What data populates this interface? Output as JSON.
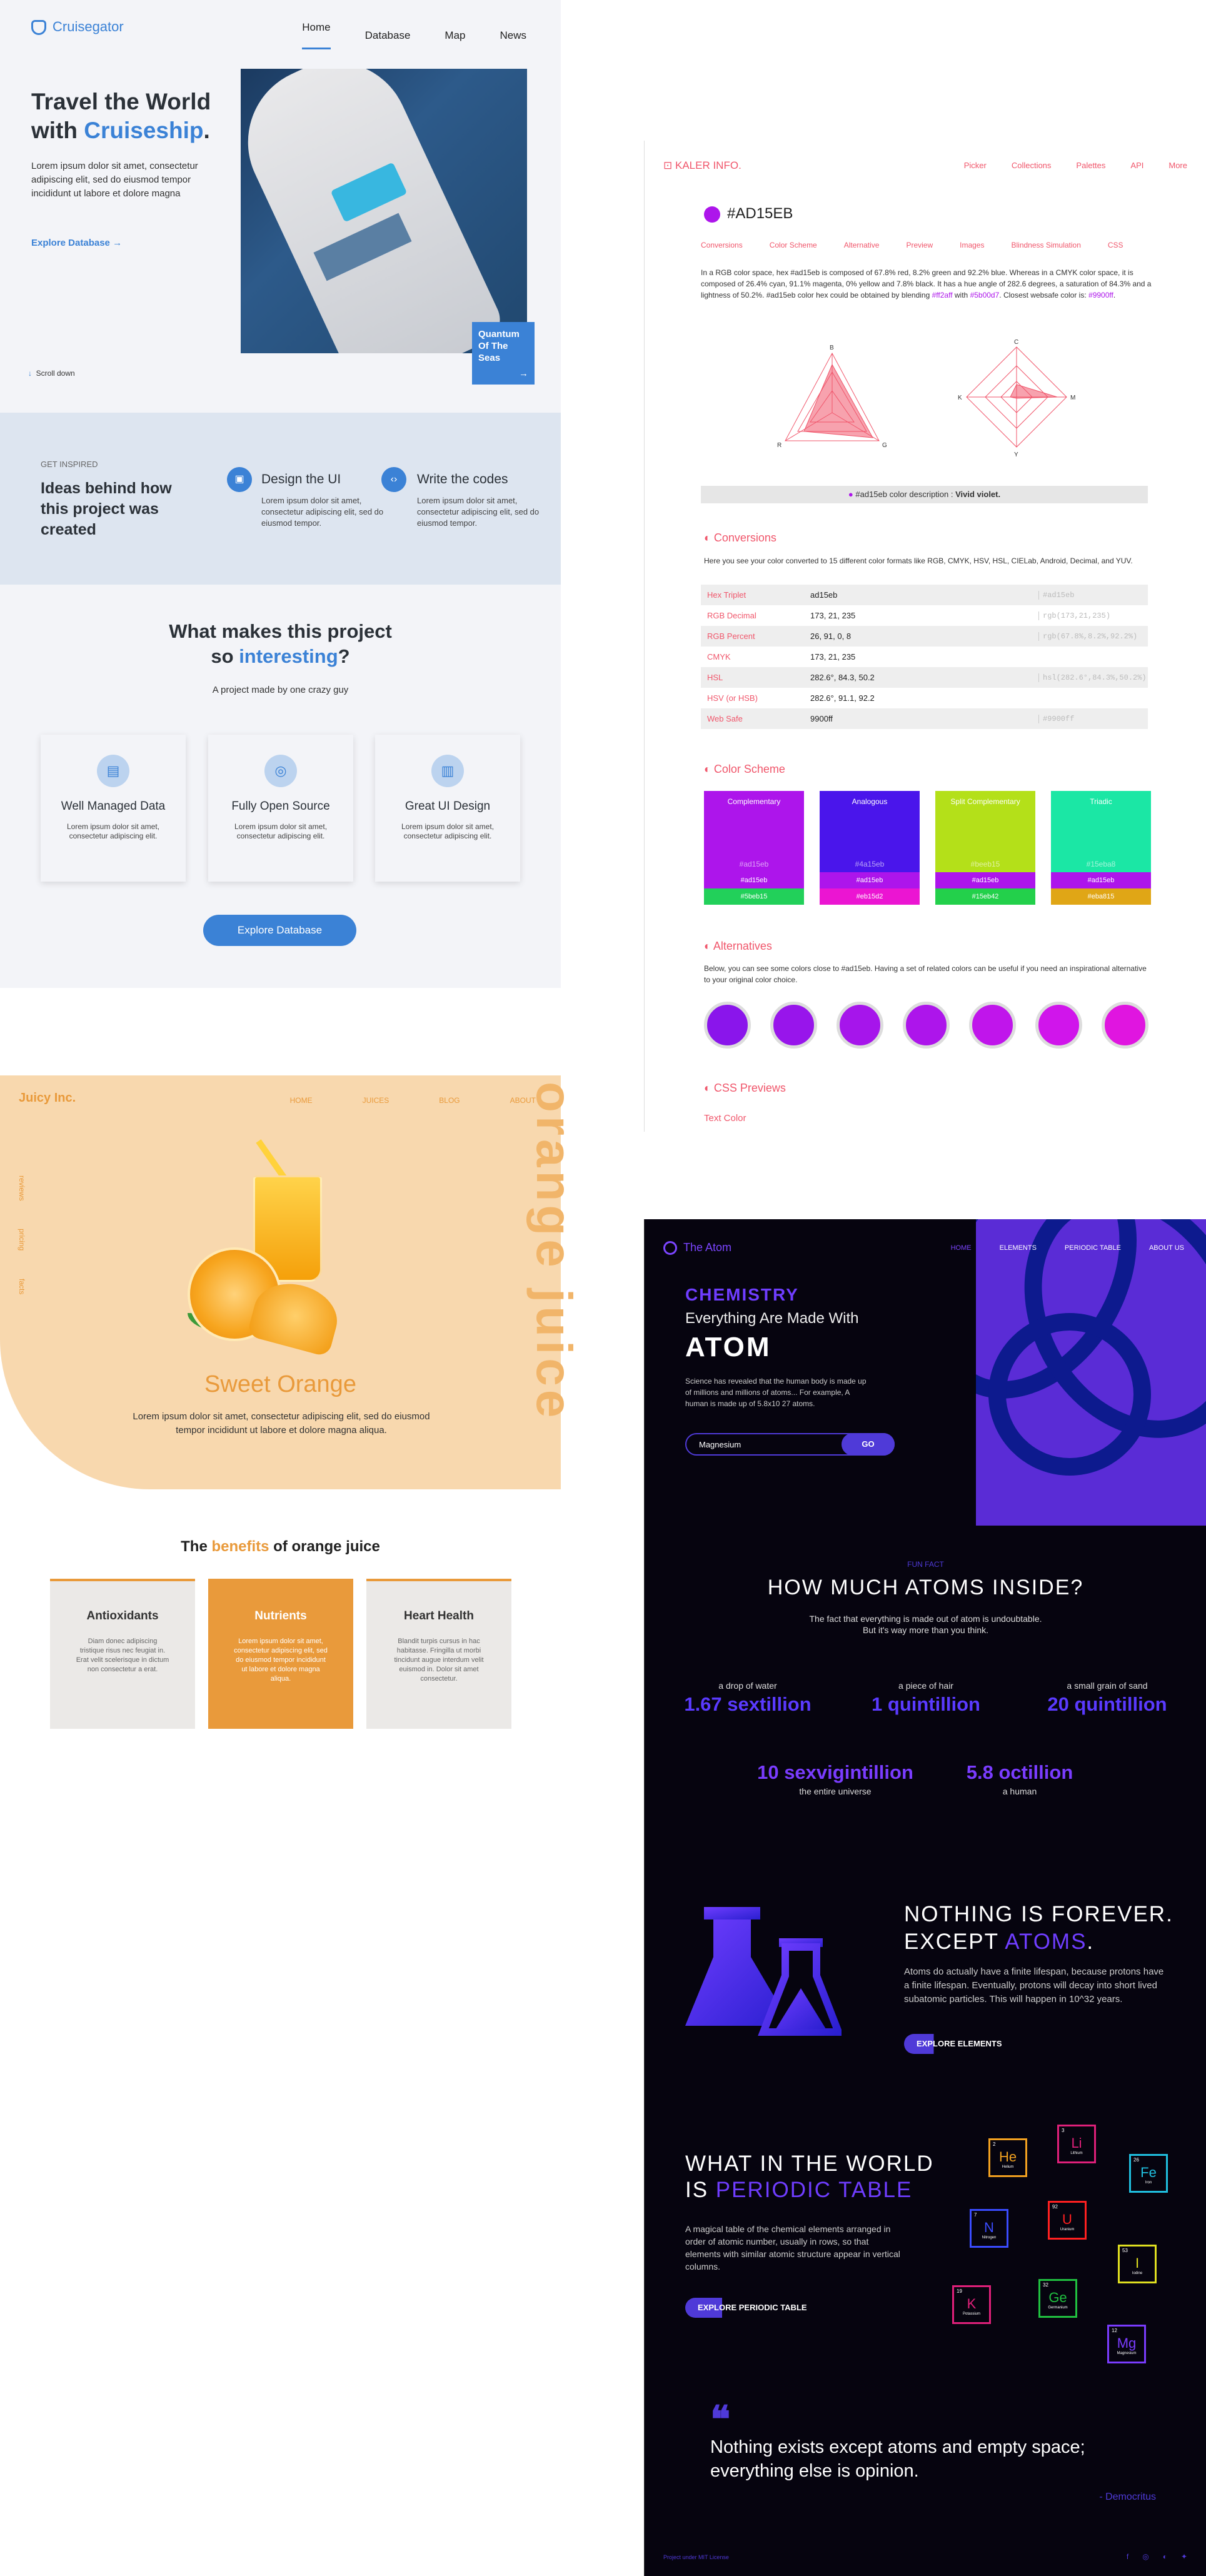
{
  "cruise": {
    "brand": "Cruisegator",
    "nav": [
      "Home",
      "Database",
      "Map",
      "News"
    ],
    "hero_title_1": "Travel the World",
    "hero_title_2": "with ",
    "hero_title_hl": "Cruiseship",
    "hero_title_end": ".",
    "hero_text": "Lorem ipsum dolor sit amet, consectetur adipiscing elit, sed do eiusmod tempor incididunt ut labore et dolore magna",
    "hero_link": "Explore Database",
    "scroll": "Scroll down",
    "caption": "Quantum Of The Seas",
    "inspired_label": "GET INSPIRED",
    "inspired_title": "Ideas behind how this project was created",
    "card1_title": "Design the UI",
    "card1_text": "Lorem ipsum dolor sit amet, consectetur adipiscing elit, sed do eiusmod tempor.",
    "card2_title": "Write the codes",
    "card2_text": "Lorem ipsum dolor sit amet, consectetur adipiscing elit, sed do eiusmod tempor.",
    "mid_title_1": "What makes this project",
    "mid_title_2": "so ",
    "mid_title_hl": "interesting",
    "mid_title_end": "?",
    "mid_sub": "A project made by one crazy guy",
    "features": [
      {
        "title": "Well Managed Data",
        "text": "Lorem ipsum dolor sit amet, consectetur adipiscing elit."
      },
      {
        "title": "Fully Open Source",
        "text": "Lorem ipsum dolor sit amet, consectetur adipiscing elit."
      },
      {
        "title": "Great UI Design",
        "text": "Lorem ipsum dolor sit amet, consectetur adipiscing elit."
      }
    ],
    "button": "Explore Database"
  },
  "kaler": {
    "brand": "KALER INFO.",
    "nav": [
      "Picker",
      "Collections",
      "Palettes",
      "API",
      "More"
    ],
    "hex": "#AD15EB",
    "tabs": [
      "Conversions",
      "Color Scheme",
      "Alternative",
      "Preview",
      "Images",
      "Blindness Simulation",
      "CSS"
    ],
    "desc_1": "In a RGB color space, hex #ad15eb is composed of 67.8% red, 8.2% green and 92.2% blue. Whereas in a CMYK color space, it is composed of 26.4% cyan, 91.1% magenta, 0% yellow and 7.8% black. It has a hue angle of 282.6 degrees, a saturation of 84.3% and a lightness of 50.2%. #ad15eb color hex could be obtained by blending ",
    "desc_blend1": "#ff2aff",
    "desc_with": " with ",
    "desc_blend2": "#5b00d7",
    "desc_2": ". Closest websafe color is: ",
    "desc_websafe": "#9900ff",
    "desc_end": ".",
    "radar1_labels": [
      "R",
      "G",
      "B"
    ],
    "radar2_labels": [
      "C",
      "M",
      "Y",
      "K"
    ],
    "color_desc_label": "#ad15eb color description : ",
    "color_desc_value": "Vivid violet.",
    "conv_title": "Conversions",
    "conv_desc": "Here you see your color converted to 15 different color formats like RGB, CMYK, HSV, HSL, CIELab, Android, Decimal, and YUV.",
    "table": [
      {
        "k": "Hex Triplet",
        "v": "ad15eb",
        "css": "#ad15eb"
      },
      {
        "k": "RGB Decimal",
        "v": "173, 21, 235",
        "css": "rgb(173,21,235)"
      },
      {
        "k": "RGB Percent",
        "v": "26, 91, 0, 8",
        "css": "rgb(67.8%,8.2%,92.2%)"
      },
      {
        "k": "CMYK",
        "v": "173, 21, 235",
        "css": ""
      },
      {
        "k": "HSL",
        "v": "282.6°, 84.3, 50.2",
        "css": "hsl(282.6°,84.3%,50.2%)"
      },
      {
        "k": "HSV (or HSB)",
        "v": "282.6°, 91.1, 92.2",
        "css": ""
      },
      {
        "k": "Web Safe",
        "v": "9900ff",
        "css": "#9900ff"
      }
    ],
    "scheme_title": "Color Scheme",
    "schemes": [
      {
        "name": "Complementary",
        "code": "#ad15eb",
        "color": "#ad15eb",
        "bars": [
          {
            "t": "#ad15eb",
            "c": "#ad15eb"
          },
          {
            "t": "#5beb15",
            "c": "#22d05a"
          }
        ]
      },
      {
        "name": "Analogous",
        "code": "#4a15eb",
        "color": "#4a15eb",
        "bars": [
          {
            "t": "#ad15eb",
            "c": "#ad15eb"
          },
          {
            "t": "#eb15d2",
            "c": "#eb15d2"
          }
        ]
      },
      {
        "name": "Split Complementary",
        "code": "#beeb15",
        "color": "#b4e019",
        "bars": [
          {
            "t": "#ad15eb",
            "c": "#ad15eb"
          },
          {
            "t": "#15eb42",
            "c": "#23d04b"
          }
        ]
      },
      {
        "name": "Triadic",
        "code": "#15eba8",
        "color": "#1be7a5",
        "bars": [
          {
            "t": "#ad15eb",
            "c": "#ad15eb"
          },
          {
            "t": "#eba815",
            "c": "#e0a616"
          }
        ]
      }
    ],
    "alt_title": "Alternatives",
    "alt_desc": "Below, you can see some colors close to #ad15eb. Having a set of related colors can be useful if you need an inspirational alternative to your original color choice.",
    "alt_colors": [
      "#8a15eb",
      "#9815eb",
      "#a615eb",
      "#ad15eb",
      "#c015eb",
      "#d015eb",
      "#e015e0"
    ],
    "css_title": "CSS Previews",
    "css_sub": "Text Color"
  },
  "juicy": {
    "brand": "Juicy Inc.",
    "nav": [
      "HOME",
      "JUICES",
      "BLOG",
      "ABOUT"
    ],
    "side": [
      "reviews",
      "pricing",
      "facts"
    ],
    "big": "orange juice",
    "sub": "Sweet Orange",
    "sub_text": "Lorem ipsum dolor sit amet, consectetur adipiscing elit, sed do eiusmod tempor incididunt ut labore et dolore magna aliqua.",
    "ben_1": "The ",
    "ben_hl": "benefits",
    "ben_2": " of orange juice",
    "cards": [
      {
        "title": "Antioxidants",
        "text": "Diam donec adipiscing tristique risus nec feugiat in. Erat velit scelerisque in dictum non consectetur a erat."
      },
      {
        "title": "Nutrients",
        "text": "Lorem ipsum dolor sit amet, consectetur adipiscing elit, sed do eiusmod tempor incididunt ut labore et dolore magna aliqua."
      },
      {
        "title": "Heart Health",
        "text": "Blandit turpis cursus in hac habitasse. Fringilla ut morbi tincidunt augue interdum velit euismod in. Dolor sit amet consectetur."
      }
    ]
  },
  "atom": {
    "brand": "The Atom",
    "nav": [
      "HOME",
      "ELEMENTS",
      "PERIODIC TABLE",
      "ABOUT US"
    ],
    "chem": "CHEMISTRY",
    "made": "Everything Are Made With",
    "atom": "ATOM",
    "intro": "Science has revealed that the human body is made up of millions and millions of atoms... For example, A human is made up of 5.8x10 27 atoms.",
    "search_value": "Magnesium",
    "go": "GO",
    "fun": "FUN FACT",
    "how": "HOW MUCH ATOMS INSIDE?",
    "how_d1": "The fact that everything is made out of atom is undoubtable.",
    "how_d2": "But it's way more than you think.",
    "stats": [
      {
        "label": "a drop of water",
        "num": "1.67 sextillion"
      },
      {
        "label": "a piece of hair",
        "num": "1 quintillion"
      },
      {
        "label": "a small grain of sand",
        "num": "20 quintillion"
      }
    ],
    "stats2": [
      {
        "num": "10 sexvigintillion",
        "label": "the entire universe"
      },
      {
        "num": "5.8 octillion",
        "label": "a human"
      }
    ],
    "nf_1": "NOTHING IS FOREVER.",
    "nf_2": "EXCEPT ",
    "nf_hl": "ATOMS",
    "nf_end": ".",
    "nf_d": "Atoms do actually have a finite lifespan, because protons have a finite lifespan. Eventually, protons will decay into short lived subatomic particles. This will happen in 10^32 years.",
    "nf_btn": "EXPLORE ELEMENTS",
    "pt_1": "WHAT IN THE WORLD",
    "pt_2": "IS ",
    "pt_hl": "PERIODIC TABLE",
    "pt_d": "A magical table of the chemical elements arranged in order of atomic number, usually in rows, so that elements with similar atomic structure appear in vertical columns.",
    "pt_btn": "EXPLORE PERIODIC TABLE",
    "elements": [
      {
        "num": "2",
        "sym": "He",
        "name": "Helium",
        "color": "#f0a020"
      },
      {
        "num": "3",
        "sym": "Li",
        "name": "Lithium",
        "color": "#e0207a"
      },
      {
        "num": "26",
        "sym": "Fe",
        "name": "Iron",
        "color": "#20c0e0"
      },
      {
        "num": "7",
        "sym": "N",
        "name": "Nitrogen",
        "color": "#3a4cff"
      },
      {
        "num": "92",
        "sym": "U",
        "name": "Uranium",
        "color": "#ff2020"
      },
      {
        "num": "53",
        "sym": "I",
        "name": "Iodine",
        "color": "#e0e020"
      },
      {
        "num": "19",
        "sym": "K",
        "name": "Potassium",
        "color": "#e0207a"
      },
      {
        "num": "32",
        "sym": "Ge",
        "name": "Germanium",
        "color": "#20c040"
      },
      {
        "num": "12",
        "sym": "Mg",
        "name": "Magnesium",
        "color": "#7a3cff"
      }
    ],
    "quote": "Nothing exists except atoms and empty space; everything else is opinion.",
    "author": "- Democritus",
    "footer": "Project under MIT License",
    "social": [
      "f",
      "◎",
      "◐",
      "✦"
    ]
  }
}
